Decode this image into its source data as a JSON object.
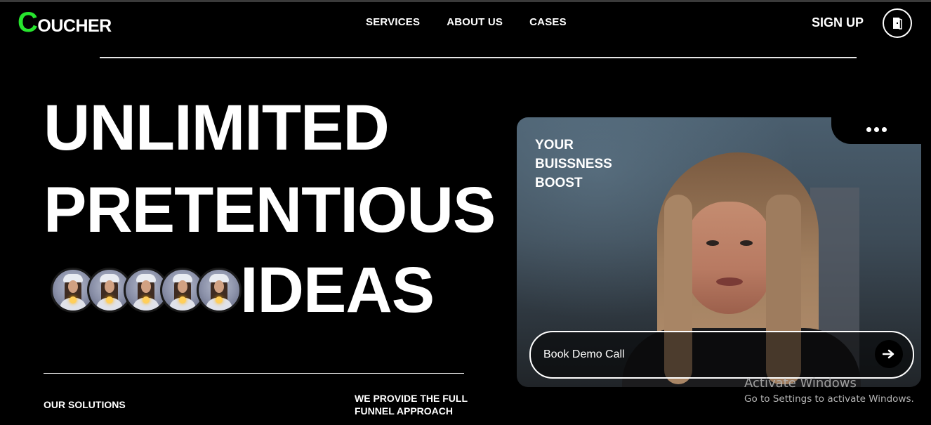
{
  "header": {
    "logo_first_letter": "C",
    "logo_rest": "OUCHER",
    "nav": [
      "SERVICES",
      "ABOUT US",
      "CASES"
    ],
    "signup_label": "SIGN UP",
    "door_icon": "door-icon"
  },
  "hero": {
    "line1": "UNLIMITED",
    "line2": "PRETENTIOUS",
    "line3": "IDEAS",
    "avatar_count": 5
  },
  "card": {
    "text_lines": [
      "YOUR",
      "BUISSNESS",
      "BOOST"
    ],
    "menu_icon": "more-dots-icon",
    "demo_label": "Book Demo Call",
    "arrow_icon": "arrow-right-icon"
  },
  "bottom": {
    "solutions": "OUR SOLUTIONS",
    "funnel": "WE PROVIDE THE FULL FUNNEL APPROACH"
  },
  "watermark": {
    "line1": "Activate Windows",
    "line2": "Go to Settings to activate Windows."
  },
  "colors": {
    "accent": "#27e52e",
    "background": "#000000"
  }
}
